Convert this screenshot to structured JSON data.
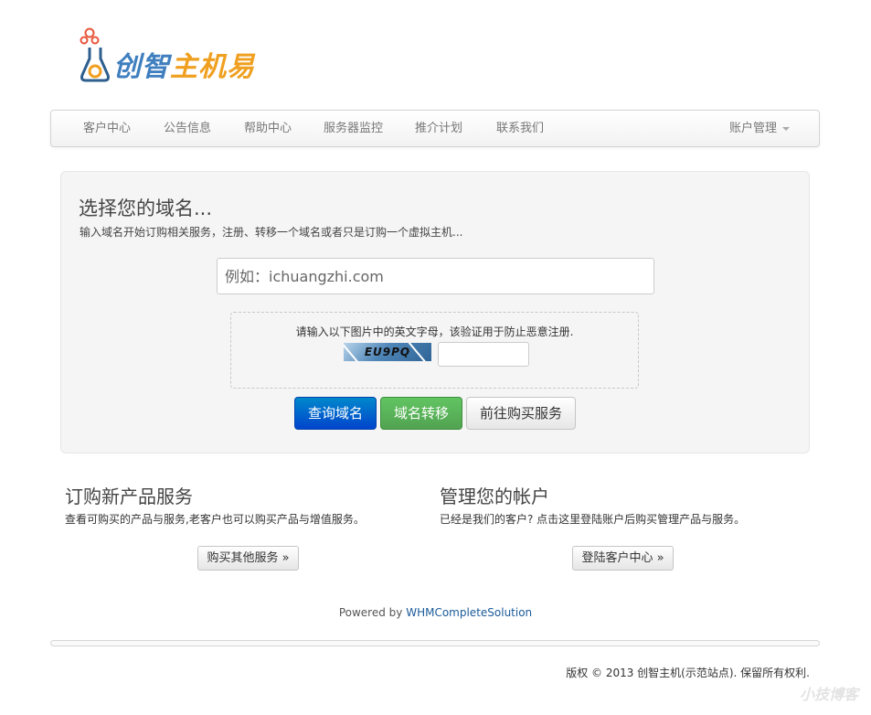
{
  "logo": {
    "text_part1": "创智",
    "text_part2": "主机易"
  },
  "nav": {
    "items": [
      "客户中心",
      "公告信息",
      "帮助中心",
      "服务器监控",
      "推介计划",
      "联系我们"
    ],
    "account": "账户管理"
  },
  "hero": {
    "title": "选择您的域名...",
    "subtitle": "输入域名开始订购相关服务，注册、转移一个域名或者只是订购一个虚拟主机...",
    "domain_placeholder": "例如：ichuangzhi.com",
    "captcha_text": "请输入以下图片中的英文字母，该验证用于防止恶意注册.",
    "captcha_code": "EU9PQ",
    "btn_search": "查询域名",
    "btn_transfer": "域名转移",
    "btn_buy": "前往购买服务"
  },
  "left": {
    "title": "订购新产品服务",
    "desc": "查看可购买的产品与服务,老客户也可以购买产品与增值服务。",
    "button": "购买其他服务 »"
  },
  "right": {
    "title": "管理您的帐户",
    "desc": "已经是我们的客户? 点击这里登陆账户后购买管理产品与服务。",
    "button": "登陆客户中心 »"
  },
  "footer": {
    "powered_by": "Powered by",
    "powered_link": "WHMCompleteSolution",
    "copyright": "版权 © 2013 创智主机(示范站点). 保留所有权利.",
    "watermark": "小技博客"
  }
}
